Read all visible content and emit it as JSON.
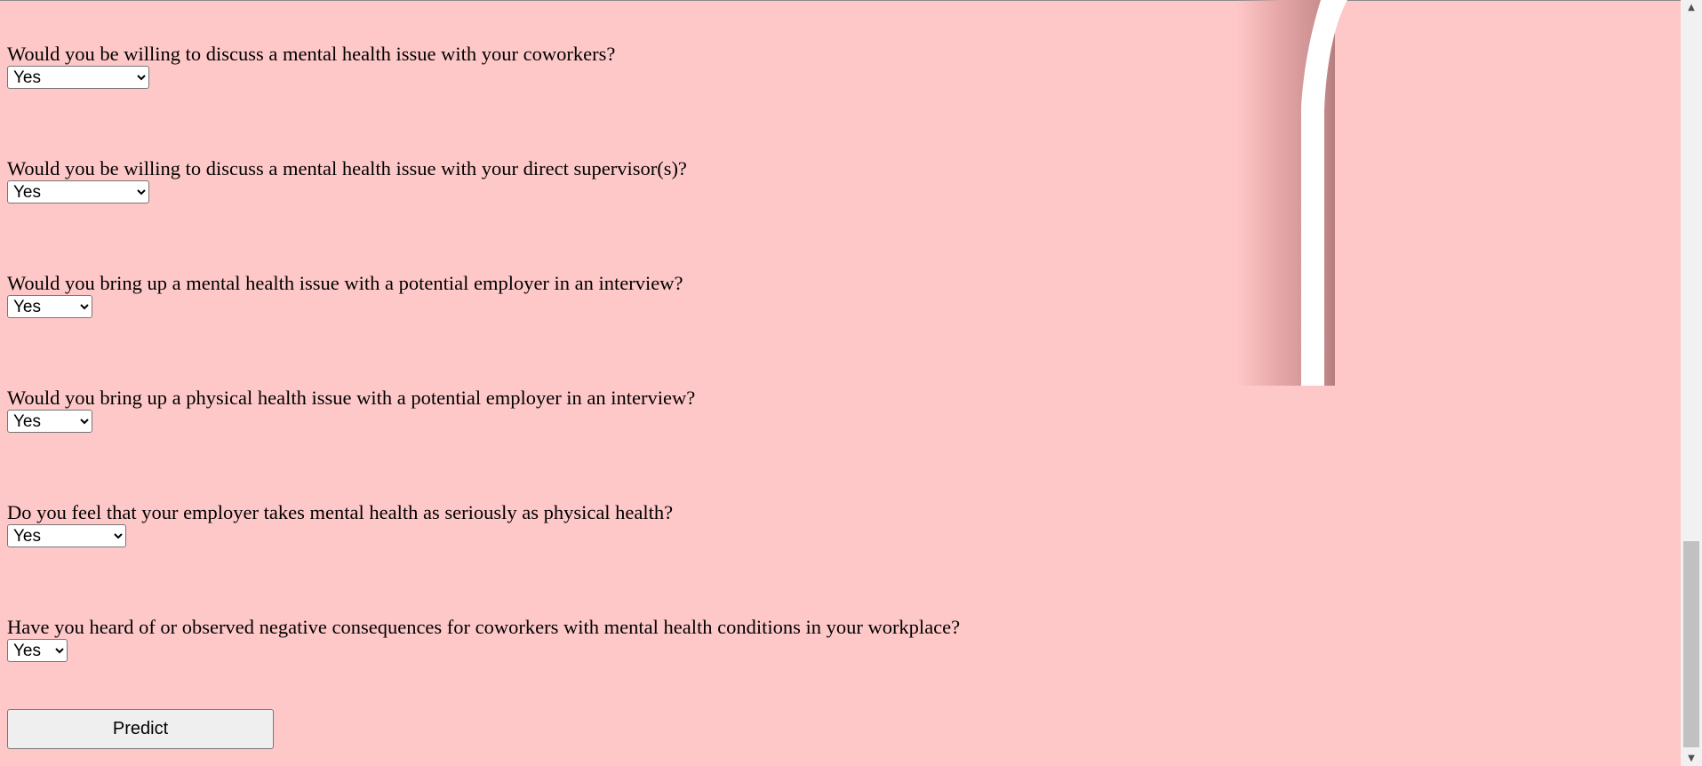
{
  "questions": [
    {
      "label": "Would you be willing to discuss a mental health issue with your coworkers?",
      "selected": "Yes"
    },
    {
      "label": "Would you be willing to discuss a mental health issue with your direct supervisor(s)?",
      "selected": "Yes"
    },
    {
      "label": "Would you bring up a mental health issue with a potential employer in an interview?",
      "selected": "Yes"
    },
    {
      "label": "Would you bring up a physical health issue with a potential employer in an interview?",
      "selected": "Yes"
    },
    {
      "label": "Do you feel that your employer takes mental health as seriously as physical health?",
      "selected": "Yes"
    },
    {
      "label": "Have you heard of or observed negative consequences for coworkers with mental health conditions in your workplace?",
      "selected": "Yes"
    }
  ],
  "predict_label": "Predict",
  "colors": {
    "page_background": "#ffc8c8",
    "button_background": "#efefef",
    "scrollbar_thumb": "#c1c1c1"
  },
  "icons": {
    "scroll_up": "triangle-up-icon",
    "scroll_down": "triangle-down-icon"
  }
}
